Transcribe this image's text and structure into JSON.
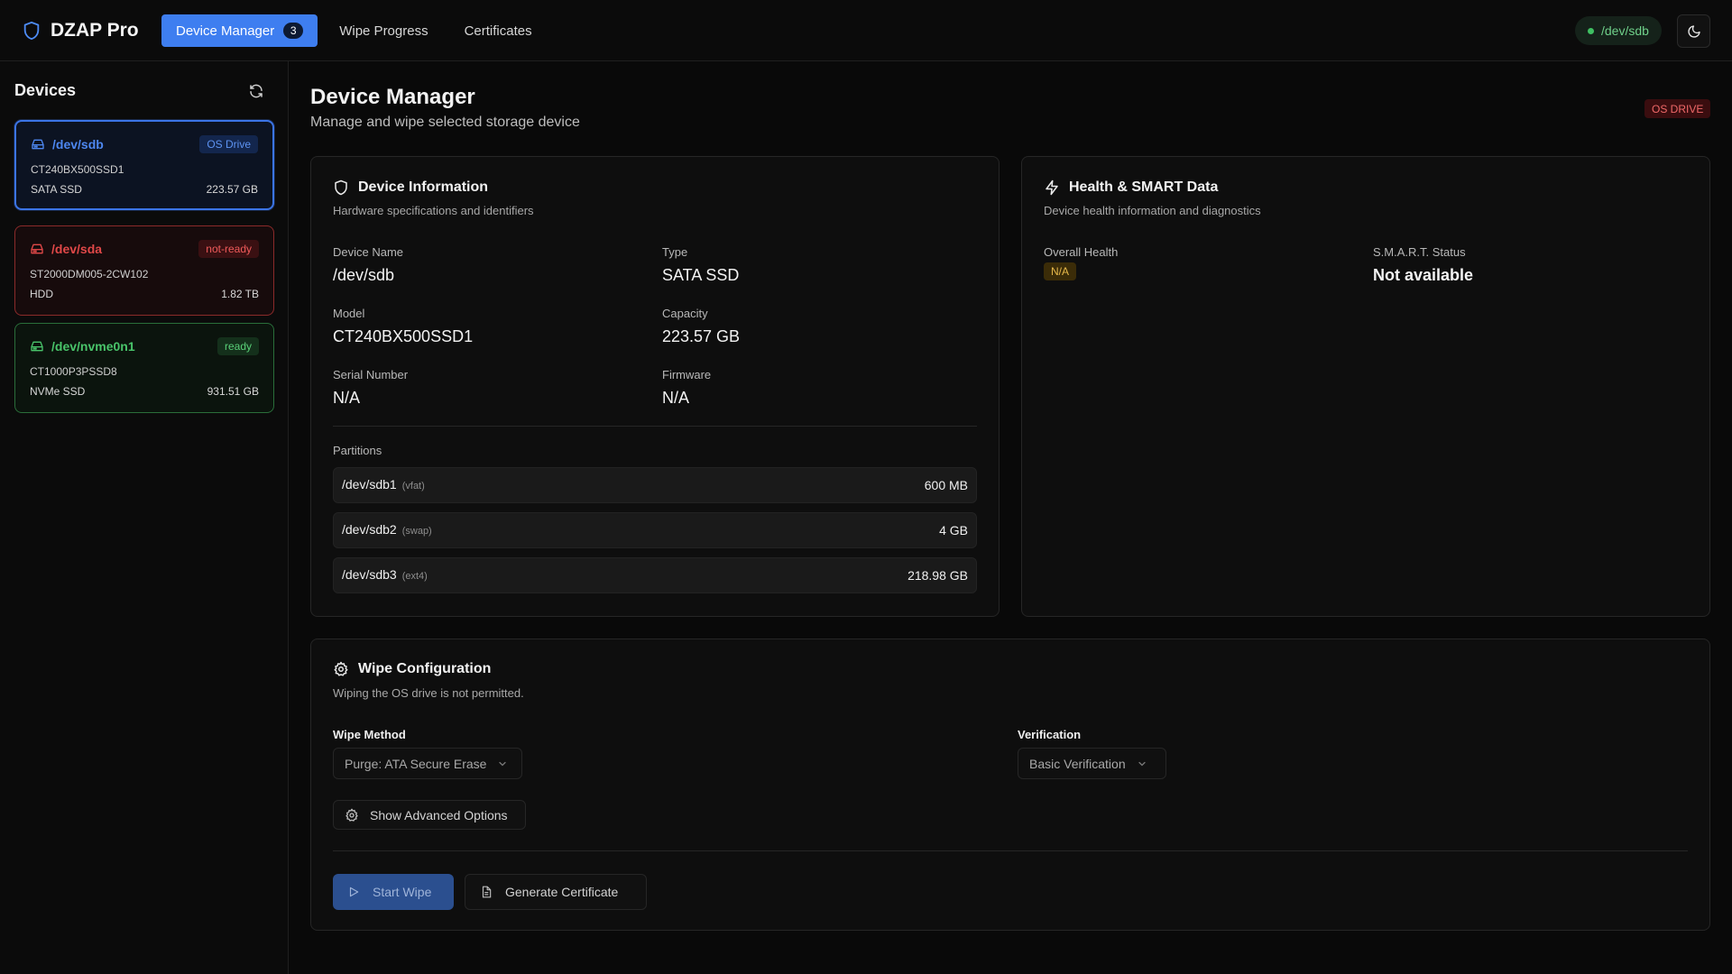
{
  "app": {
    "name": "DZAP Pro",
    "nav": [
      {
        "label": "Device Manager",
        "badge": "3",
        "active": true
      },
      {
        "label": "Wipe Progress"
      },
      {
        "label": "Certificates"
      }
    ],
    "status_pill": "/dev/sdb"
  },
  "sidebar": {
    "title": "Devices",
    "devices": [
      {
        "name": "/dev/sdb",
        "tag": "OS Drive",
        "model": "CT240BX500SSD1",
        "type": "SATA SSD",
        "size": "223.57 GB"
      },
      {
        "name": "/dev/sda",
        "tag": "not-ready",
        "model": "ST2000DM005-2CW102",
        "type": "HDD",
        "size": "1.82 TB"
      },
      {
        "name": "/dev/nvme0n1",
        "tag": "ready",
        "model": "CT1000P3PSSD8",
        "type": "NVMe SSD",
        "size": "931.51 GB"
      }
    ]
  },
  "main": {
    "title": "Device Manager",
    "subtitle": "Manage and wipe selected storage device",
    "badge": "OS DRIVE",
    "device_info": {
      "title": "Device Information",
      "subtitle": "Hardware specifications and identifiers",
      "fields": {
        "device_name": {
          "label": "Device Name",
          "value": "/dev/sdb"
        },
        "type": {
          "label": "Type",
          "value": "SATA SSD"
        },
        "model": {
          "label": "Model",
          "value": "CT240BX500SSD1"
        },
        "capacity": {
          "label": "Capacity",
          "value": "223.57 GB"
        },
        "serial": {
          "label": "Serial Number",
          "value": "N/A"
        },
        "firmware": {
          "label": "Firmware",
          "value": "N/A"
        }
      },
      "partitions_label": "Partitions",
      "partitions": [
        {
          "name": "/dev/sdb1",
          "fs": "(vfat)",
          "size": "600 MB"
        },
        {
          "name": "/dev/sdb2",
          "fs": "(swap)",
          "size": "4 GB"
        },
        {
          "name": "/dev/sdb3",
          "fs": "(ext4)",
          "size": "218.98 GB"
        }
      ]
    },
    "health": {
      "title": "Health & SMART Data",
      "subtitle": "Device health information and diagnostics",
      "overall_label": "Overall Health",
      "overall_value": "N/A",
      "smart_label": "S.M.A.R.T. Status",
      "smart_value": "Not available"
    },
    "wipe": {
      "title": "Wipe Configuration",
      "subtitle": "Wiping the OS drive is not permitted.",
      "method_label": "Wipe Method",
      "method_value": "Purge: ATA Secure Erase",
      "verification_label": "Verification",
      "verification_value": "Basic Verification",
      "advanced_label": "Show Advanced Options",
      "start_label": "Start Wipe",
      "cert_label": "Generate Certificate"
    }
  },
  "colors": {
    "accent": "#3e7ef0",
    "selected_border": "#3b74e6",
    "error": "#e04848",
    "success": "#3fbf62",
    "warning": "#e6b84a"
  },
  "icons": [
    "shield-icon",
    "refresh-icon",
    "hard-drive-icon",
    "moon-icon",
    "zap-icon",
    "gear-icon",
    "chevron-down-icon",
    "play-icon",
    "file-icon"
  ]
}
